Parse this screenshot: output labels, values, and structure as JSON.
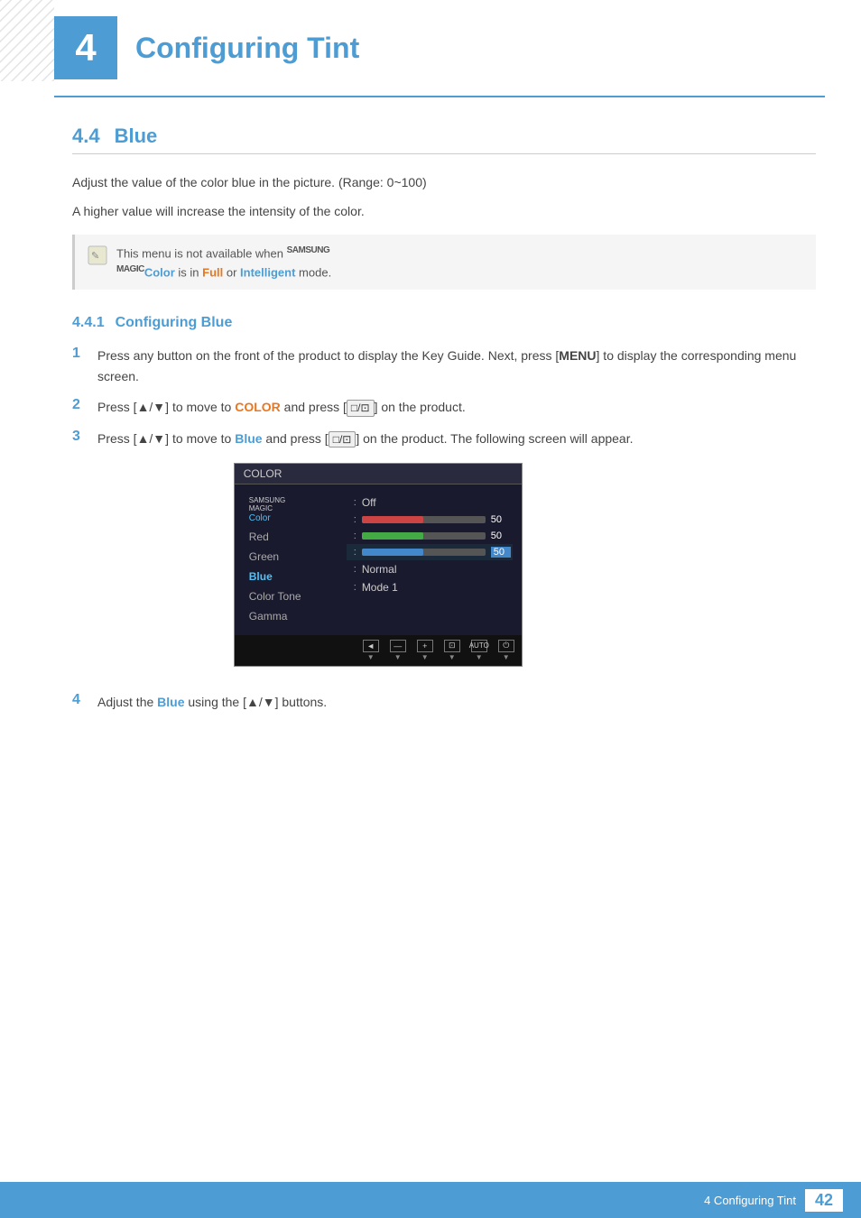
{
  "chapter": {
    "number": "4",
    "title": "Configuring Tint",
    "accent_color": "#4d9dd4"
  },
  "section": {
    "number": "4.4",
    "title": "Blue"
  },
  "body_paragraphs": [
    "Adjust the value of the color blue in the picture. (Range: 0~100)",
    "A higher value will increase the intensity of the color."
  ],
  "note": {
    "text": "This menu is not available when ",
    "samsung_magic": "SAMSUNG\nMAGIC",
    "color_label": "Color",
    "suffix": " is in ",
    "full_mode": "Full",
    "or": " or ",
    "intelligent_mode": "Intelligent",
    "end": " mode."
  },
  "subsection": {
    "number": "4.4.1",
    "title": "Configuring Blue"
  },
  "steps": [
    {
      "number": "1",
      "parts": [
        {
          "text": "Press any button on the front of the product to display the Key Guide. Next, press ["
        },
        {
          "text": "MENU",
          "bold": true
        },
        {
          "text": "] to display the corresponding menu screen."
        }
      ]
    },
    {
      "number": "2",
      "parts": [
        {
          "text": "Press [▲/▼] to move to "
        },
        {
          "text": "COLOR",
          "bold": true,
          "color": "orange"
        },
        {
          "text": " and press ["
        },
        {
          "text": "□/⊡",
          "btn": true
        },
        {
          "text": "] on the product."
        }
      ]
    },
    {
      "number": "3",
      "parts": [
        {
          "text": "Press [▲/▼] to move to "
        },
        {
          "text": "Blue",
          "bold": true,
          "color": "blue"
        },
        {
          "text": " and press ["
        },
        {
          "text": "□/⊡",
          "btn": true
        },
        {
          "text": "] on the product. The following screen will appear."
        }
      ]
    },
    {
      "number": "4",
      "parts": [
        {
          "text": "Adjust the "
        },
        {
          "text": "Blue",
          "bold": true,
          "color": "blue"
        },
        {
          "text": " using the [▲/▼] buttons."
        }
      ]
    }
  ],
  "monitor": {
    "title": "COLOR",
    "menu_items": [
      {
        "label": "SAMSUNG\nMAGIC Color",
        "type": "samsung"
      },
      {
        "label": "Red",
        "type": "normal"
      },
      {
        "label": "Green",
        "type": "normal"
      },
      {
        "label": "Blue",
        "type": "active"
      },
      {
        "label": "Color Tone",
        "type": "normal"
      },
      {
        "label": "Gamma",
        "type": "normal"
      }
    ],
    "menu_values": [
      {
        "type": "text",
        "value": "Off"
      },
      {
        "type": "bar",
        "bar_type": "red",
        "fill": 50,
        "value": "50"
      },
      {
        "type": "bar",
        "bar_type": "green",
        "fill": 50,
        "value": "50"
      },
      {
        "type": "bar",
        "bar_type": "blue",
        "fill": 50,
        "value": "50",
        "highlight": true
      },
      {
        "type": "text",
        "value": "Normal"
      },
      {
        "type": "text",
        "value": "Mode 1"
      }
    ],
    "toolbar_buttons": [
      {
        "icon": "◄",
        "label": "▼"
      },
      {
        "icon": "—",
        "label": "▼"
      },
      {
        "icon": "+",
        "label": "▼"
      },
      {
        "icon": "⊡",
        "label": "▼"
      },
      {
        "icon": "AUTO",
        "label": "▼"
      },
      {
        "icon": "⏻",
        "label": "▼"
      }
    ]
  },
  "footer": {
    "text": "4 Configuring Tint",
    "page_number": "42"
  }
}
